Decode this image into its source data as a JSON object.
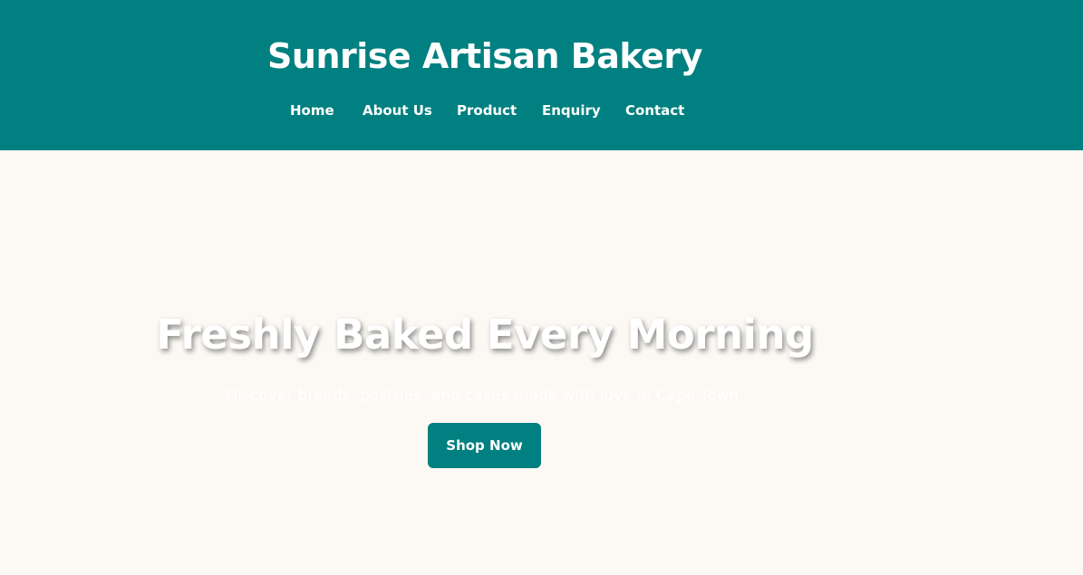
{
  "header": {
    "title": "Sunrise Artisan Bakery",
    "background_color": "#008080",
    "nav": [
      {
        "label": "Home"
      },
      {
        "label": "About Us"
      },
      {
        "label": "Product"
      },
      {
        "label": "Enquiry"
      },
      {
        "label": "Contact"
      }
    ]
  },
  "hero": {
    "title": "Freshly Baked Every Morning",
    "subtitle": "Discover breads, pastries, and cakes made with love in Cape Town.",
    "cta_label": "Shop Now",
    "background_color": "#fcf9f5",
    "accent_color": "#008080"
  }
}
